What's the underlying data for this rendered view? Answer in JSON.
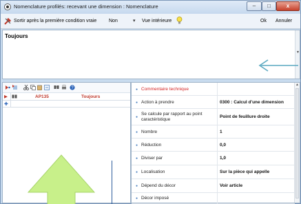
{
  "window": {
    "title": "Nomenclature profilés: recevant une dimension : Nomenclature",
    "min_glyph": "–",
    "max_glyph": "□",
    "close_glyph": "x"
  },
  "toolbar": {
    "condition_label": "Sortir après la première condition vraie",
    "condition_value": "Non",
    "view_label": "Vue intérieure",
    "ok_label": "Ok",
    "cancel_label": "Annuler"
  },
  "textarea": {
    "value": "Toujours"
  },
  "left_table": {
    "row": {
      "code": "AP135",
      "condition": "Toujours"
    }
  },
  "properties": [
    {
      "label": "Commentaire technique",
      "value": "",
      "red": true
    },
    {
      "label": "Action à prendre",
      "value": "0300 : Calcul d'une dimension"
    },
    {
      "label": "Se calcule par rapport au point caractéristique",
      "value": "Point de feuillure droite"
    },
    {
      "label": "Nombre",
      "value": "1"
    },
    {
      "label": "Réduction",
      "value": "0,0"
    },
    {
      "label": "Diviser par",
      "value": "1,0"
    },
    {
      "label": "Localisation",
      "value": "Sur la pièce qui appelle"
    },
    {
      "label": "Dépend du décor",
      "value": "Voir article"
    },
    {
      "label": "Décor imposé",
      "value": ""
    }
  ],
  "colors": {
    "annotation_arrow_green": "#c8f08a",
    "annotation_arrow_teal": "#5aa8c0",
    "accent_red": "#d42323"
  }
}
